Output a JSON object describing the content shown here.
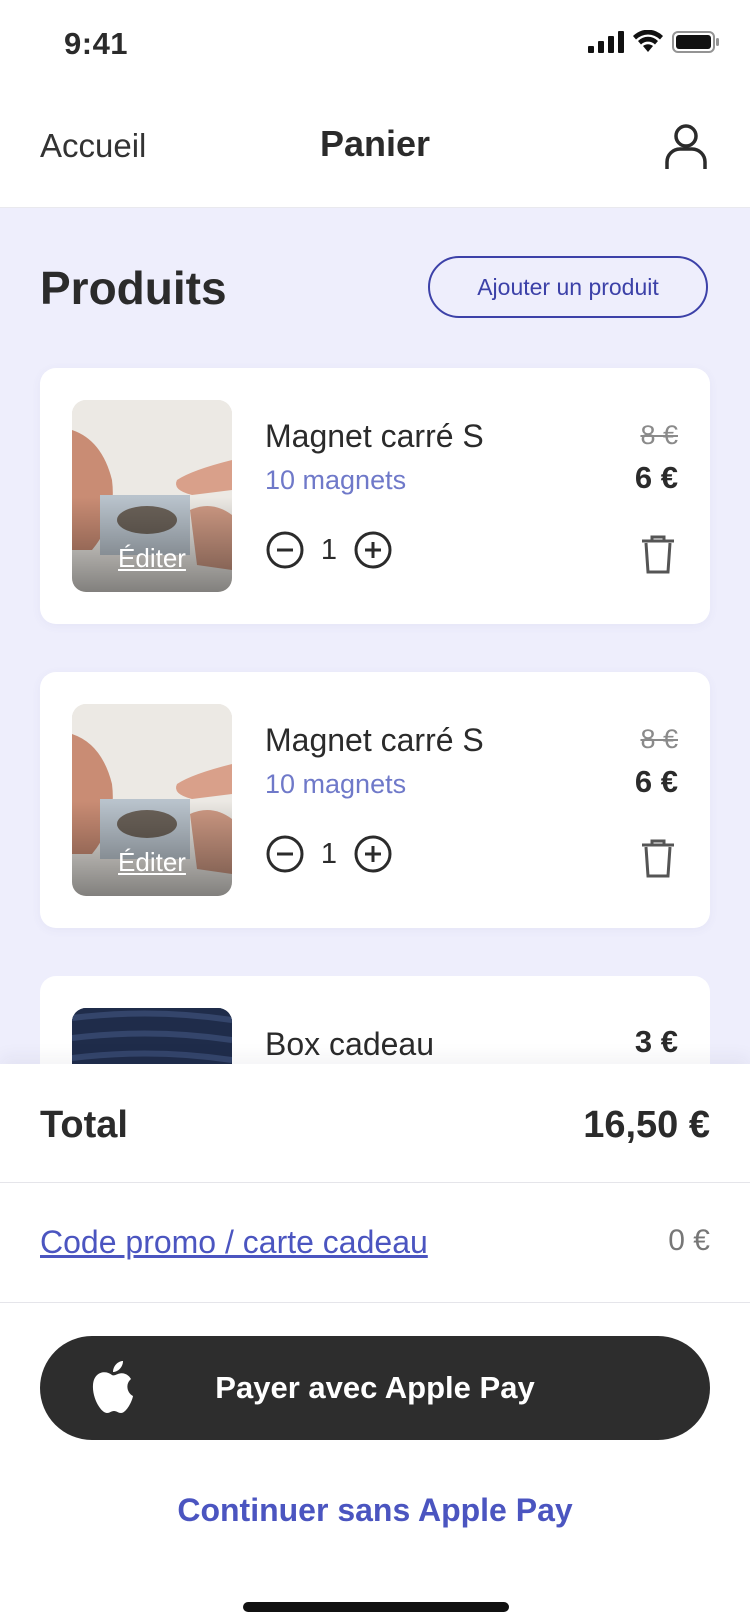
{
  "status_bar": {
    "time": "9:41"
  },
  "nav": {
    "back_label": "Accueil",
    "title": "Panier",
    "user_icon": "user-icon"
  },
  "section": {
    "title": "Produits",
    "add_button": "Ajouter un produit"
  },
  "cart_items": [
    {
      "name": "Magnet carré S",
      "detail": "10 magnets",
      "old_price": "8 €",
      "price": "6 €",
      "quantity": "1",
      "edit_label": "Éditer"
    },
    {
      "name": "Magnet carré S",
      "detail": "10 magnets",
      "old_price": "8 €",
      "price": "6 €",
      "quantity": "1",
      "edit_label": "Éditer"
    },
    {
      "name": "Box cadeau",
      "price": "3 €"
    }
  ],
  "summary": {
    "total_label": "Total",
    "total_value": "16,50 €",
    "promo_label": "Code promo / carte cadeau",
    "promo_value": "0 €",
    "apple_pay_label": "Payer avec Apple Pay",
    "continue_label": "Continuer sans Apple Pay"
  },
  "colors": {
    "accent": "#4b55c0",
    "background": "#eeeefc",
    "dark": "#2d2d2d",
    "muted_blue": "#6f79c9"
  }
}
